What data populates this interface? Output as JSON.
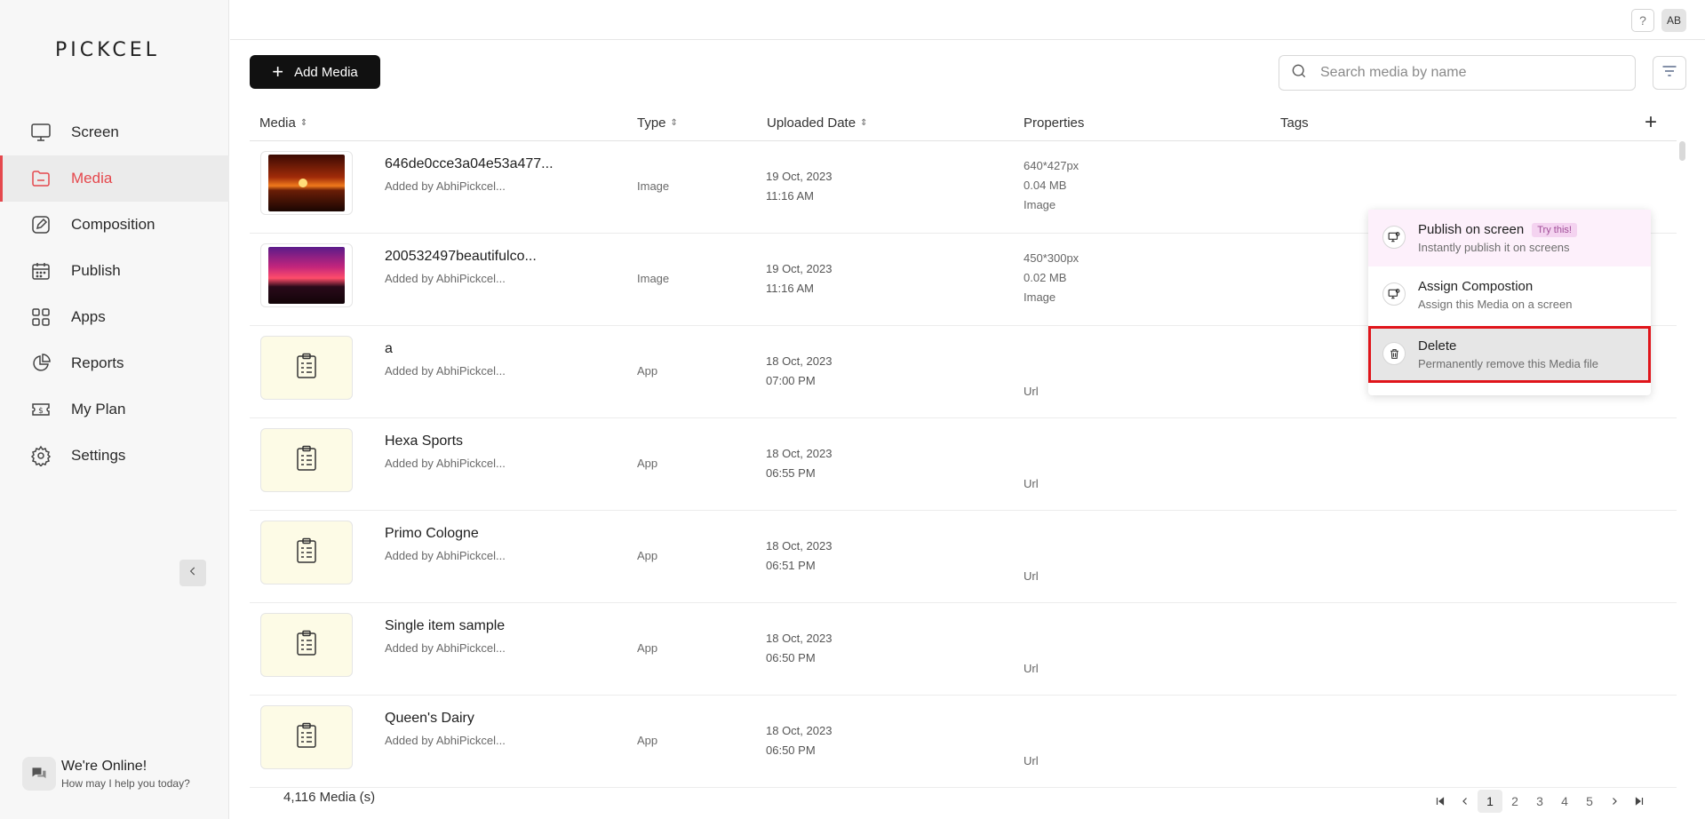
{
  "brand": {
    "logo_text": "PICKCEL"
  },
  "sidebar": {
    "items": [
      {
        "label": "Screen",
        "icon": "monitor-icon"
      },
      {
        "label": "Media",
        "icon": "folder-icon",
        "active": true
      },
      {
        "label": "Composition",
        "icon": "edit-icon"
      },
      {
        "label": "Publish",
        "icon": "calendar-icon"
      },
      {
        "label": "Apps",
        "icon": "grid-icon"
      },
      {
        "label": "Reports",
        "icon": "pie-chart-icon"
      },
      {
        "label": "My Plan",
        "icon": "dollar-ticket-icon"
      },
      {
        "label": "Settings",
        "icon": "gear-icon"
      }
    ],
    "collapse_icon": "chevron-left-icon",
    "chat": {
      "title": "We're Online!",
      "subtitle": "How may I help you today?"
    }
  },
  "topbar": {
    "help_label": "?",
    "avatar_initials": "AB"
  },
  "toolbar": {
    "add_media_label": "Add Media",
    "search_placeholder": "Search media by name",
    "filter_icon": "filter-icon"
  },
  "table": {
    "columns": [
      "Media",
      "Type",
      "Uploaded Date",
      "Properties",
      "Tags"
    ],
    "add_column_label": "+",
    "rows": [
      {
        "name": "646de0cce3a04e53a477...",
        "added_by": "Added by AbhiPickcel...",
        "type": "Image",
        "date": "19 Oct, 2023",
        "time": "11:16 AM",
        "prop1": "640*427px",
        "prop2": "0.04 MB",
        "prop3": "Image",
        "thumb": "sunset-image"
      },
      {
        "name": "200532497beautifulco...",
        "added_by": "Added by AbhiPickcel...",
        "type": "Image",
        "date": "19 Oct, 2023",
        "time": "11:16 AM",
        "prop1": "450*300px",
        "prop2": "0.02 MB",
        "prop3": "Image",
        "thumb": "pink-sunset-image"
      },
      {
        "name": "a",
        "added_by": "Added by AbhiPickcel...",
        "type": "App",
        "date": "18 Oct, 2023",
        "time": "07:00 PM",
        "prop_url": "Url",
        "thumb": "app-icon"
      },
      {
        "name": "Hexa Sports",
        "added_by": "Added by AbhiPickcel...",
        "type": "App",
        "date": "18 Oct, 2023",
        "time": "06:55 PM",
        "prop_url": "Url",
        "thumb": "app-icon"
      },
      {
        "name": "Primo Cologne",
        "added_by": "Added by AbhiPickcel...",
        "type": "App",
        "date": "18 Oct, 2023",
        "time": "06:51 PM",
        "prop_url": "Url",
        "thumb": "app-icon"
      },
      {
        "name": "Single item sample",
        "added_by": "Added by AbhiPickcel...",
        "type": "App",
        "date": "18 Oct, 2023",
        "time": "06:50 PM",
        "prop_url": "Url",
        "thumb": "app-icon"
      },
      {
        "name": "Queen's Dairy",
        "added_by": "Added by AbhiPickcel...",
        "type": "App",
        "date": "18 Oct, 2023",
        "time": "06:50 PM",
        "prop_url": "Url",
        "thumb": "app-icon"
      }
    ]
  },
  "context_menu": {
    "items": [
      {
        "title": "Publish on screen",
        "badge": "Try this!",
        "desc": "Instantly publish it on screens",
        "icon": "publish-screen-icon"
      },
      {
        "title": "Assign Compostion",
        "desc": "Assign this Media on a screen",
        "icon": "assign-screen-icon"
      },
      {
        "title": "Delete",
        "desc": "Permanently remove this Media file",
        "icon": "trash-icon"
      }
    ]
  },
  "footer": {
    "count_label": "4,116 Media (s)",
    "pages": [
      "1",
      "2",
      "3",
      "4",
      "5"
    ],
    "current_page": "1"
  },
  "colors": {
    "accent": "#e5484d",
    "highlight_border": "#e0151b",
    "try_badge_bg": "#f4d3f0"
  }
}
